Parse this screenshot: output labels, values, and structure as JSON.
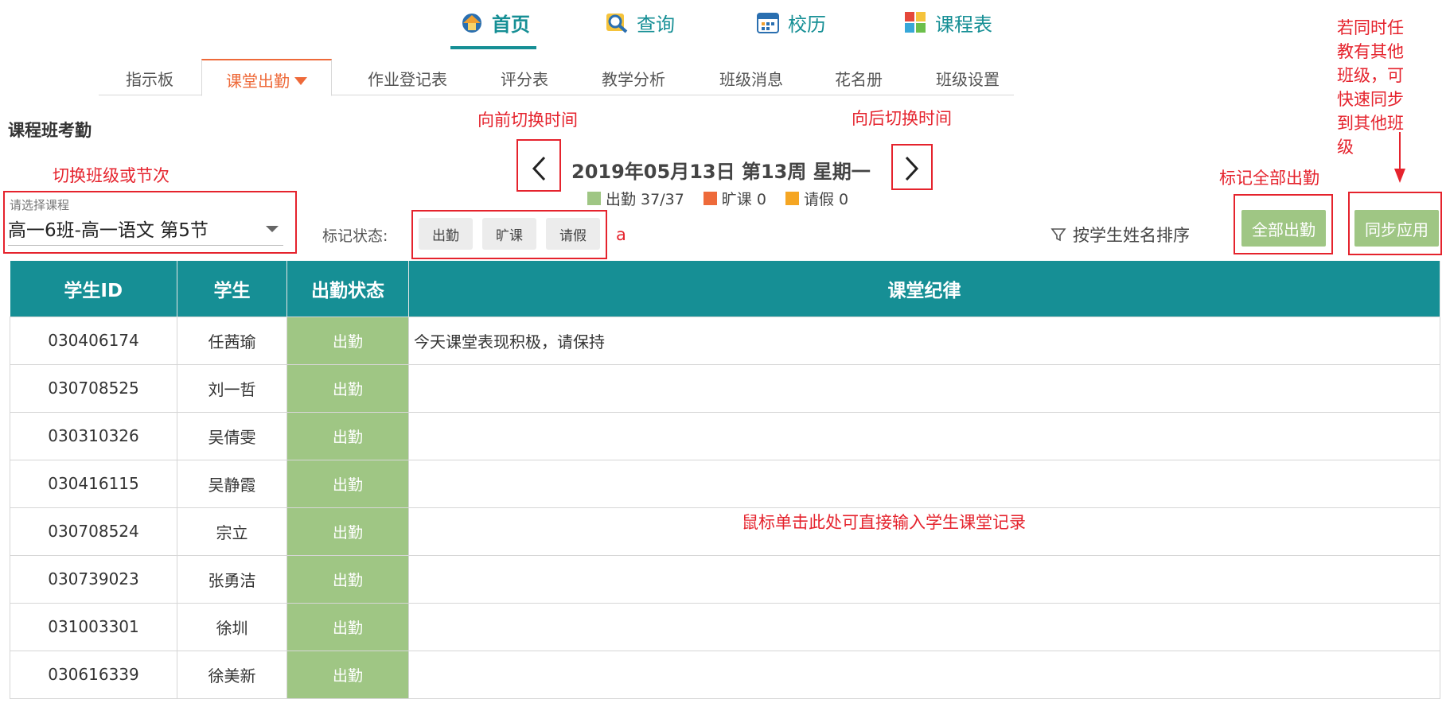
{
  "topnav": [
    {
      "label": "首页",
      "icon": "home-icon",
      "active": true
    },
    {
      "label": "查询",
      "icon": "search-person-icon",
      "active": false
    },
    {
      "label": "校历",
      "icon": "calendar-icon",
      "active": false
    },
    {
      "label": "课程表",
      "icon": "timetable-icon",
      "active": false
    }
  ],
  "subnav": [
    "指示板",
    "课堂出勤",
    "作业登记表",
    "评分表",
    "教学分析",
    "班级消息",
    "花名册",
    "班级设置"
  ],
  "page_title": "课程班考勤",
  "date_label": "2019年05月13日 第13周 星期一",
  "legend": [
    {
      "label": "出勤 37/37",
      "color": "#9fc684"
    },
    {
      "label": "旷课 0",
      "color": "#ee6a3a"
    },
    {
      "label": "请假 0",
      "color": "#f5a623"
    }
  ],
  "course_select": {
    "hint": "请选择课程",
    "value": "高一6班-高一语文 第5节"
  },
  "mark_label": "标记状态:",
  "status_chips": [
    "出勤",
    "旷课",
    "请假"
  ],
  "sort_label": "按学生姓名排序",
  "buttons": {
    "all_present": "全部出勤",
    "sync_apply": "同步应用"
  },
  "table": {
    "headers": [
      "学生ID",
      "学生",
      "出勤状态",
      "课堂纪律"
    ],
    "rows": [
      {
        "id": "030406174",
        "name": "任茜瑜",
        "status": "出勤",
        "note": "今天课堂表现积极，请保持"
      },
      {
        "id": "030708525",
        "name": "刘一哲",
        "status": "出勤",
        "note": ""
      },
      {
        "id": "030310326",
        "name": "吴倩雯",
        "status": "出勤",
        "note": ""
      },
      {
        "id": "030416115",
        "name": "吴静霞",
        "status": "出勤",
        "note": ""
      },
      {
        "id": "030708524",
        "name": "宗立",
        "status": "出勤",
        "note": ""
      },
      {
        "id": "030739023",
        "name": "张勇洁",
        "status": "出勤",
        "note": ""
      },
      {
        "id": "031003301",
        "name": "徐圳",
        "status": "出勤",
        "note": ""
      },
      {
        "id": "030616339",
        "name": "徐美新",
        "status": "出勤",
        "note": ""
      }
    ]
  },
  "annotations": {
    "prev_time": "向前切换时间",
    "next_time": "向后切换时间",
    "switch_class": "切换班级或节次",
    "mark_all": "标记全部出勤",
    "sync_note": "若同时任教有其他班级，可快速同步到其他班级",
    "click_note": "鼠标单击此处可直接输入学生课堂记录",
    "letter_a": "a"
  },
  "colors": {
    "teal": "#168f95",
    "green": "#9fc684",
    "orange": "#ee6a3a",
    "annotation_red": "#e5232d"
  }
}
